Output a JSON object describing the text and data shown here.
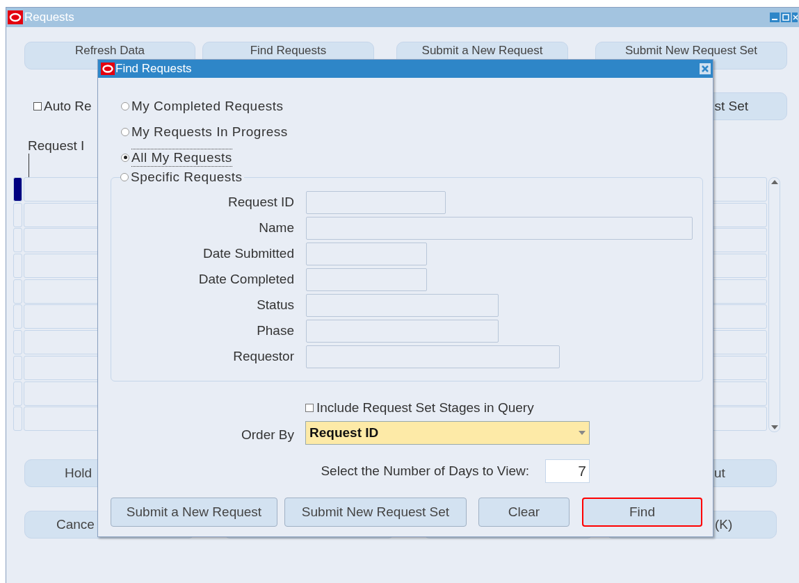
{
  "window": {
    "title": "Requests"
  },
  "toolbar_buttons": [
    {
      "label": "Refresh Data"
    },
    {
      "label": "Find Requests"
    },
    {
      "label": "Submit a New Request"
    },
    {
      "label": "Submit New Request Set"
    }
  ],
  "auto_refresh": {
    "label": "Auto Re",
    "checked": false
  },
  "partial_button": {
    "label": "st Set"
  },
  "table": {
    "column_header": "Request I",
    "rows": [
      {
        "selected": true
      },
      {
        "selected": false
      },
      {
        "selected": false
      },
      {
        "selected": false
      },
      {
        "selected": false
      },
      {
        "selected": false
      },
      {
        "selected": false
      },
      {
        "selected": false
      },
      {
        "selected": false
      },
      {
        "selected": false
      }
    ]
  },
  "bottom_buttons": [
    [
      {
        "label": "Hold"
      },
      {
        "label": "ut"
      }
    ],
    [
      {
        "label": "Cance"
      },
      {
        "label": "(K)"
      }
    ]
  ],
  "dialog": {
    "title": "Find Requests",
    "options": [
      {
        "label": "My Completed Requests",
        "selected": false
      },
      {
        "label": "My Requests In Progress",
        "selected": false
      },
      {
        "label": "All My Requests",
        "selected": true
      }
    ],
    "specific": {
      "label": "Specific Requests",
      "selected": false,
      "fields": [
        {
          "label": "Request ID"
        },
        {
          "label": "Name"
        },
        {
          "label": "Date Submitted"
        },
        {
          "label": "Date Completed"
        },
        {
          "label": "Status"
        },
        {
          "label": "Phase"
        },
        {
          "label": "Requestor"
        }
      ]
    },
    "include_stages": {
      "label": "Include Request Set Stages in Query",
      "checked": false
    },
    "order_by": {
      "label": "Order By",
      "value": "Request ID"
    },
    "days": {
      "label": "Select the Number of Days to View:",
      "value": "7"
    },
    "buttons": [
      {
        "label": "Submit a New Request",
        "focused": false
      },
      {
        "label": "Submit New Request Set",
        "focused": false
      },
      {
        "label": "Clear",
        "focused": false
      },
      {
        "label": "Find",
        "focused": true
      }
    ]
  }
}
